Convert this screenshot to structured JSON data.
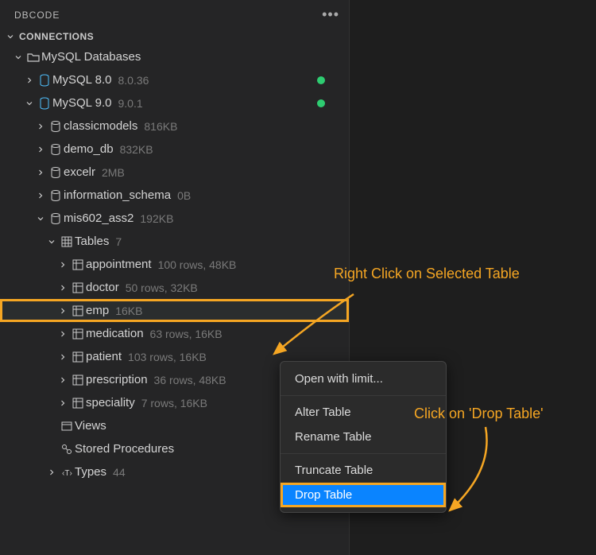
{
  "panel": {
    "title": "DBCODE",
    "section": "CONNECTIONS"
  },
  "tree": {
    "group": "MySQL Databases",
    "servers": [
      {
        "name": "MySQL 8.0",
        "version": "8.0.36",
        "expanded": false,
        "online": true
      },
      {
        "name": "MySQL 9.0",
        "version": "9.0.1",
        "expanded": true,
        "online": true
      }
    ],
    "databases": [
      {
        "name": "classicmodels",
        "size": "816KB"
      },
      {
        "name": "demo_db",
        "size": "832KB"
      },
      {
        "name": "excelr",
        "size": "2MB"
      },
      {
        "name": "information_schema",
        "size": "0B"
      },
      {
        "name": "mis602_ass2",
        "size": "192KB",
        "expanded": true
      }
    ],
    "tables_header": {
      "label": "Tables",
      "count": "7"
    },
    "tables": [
      {
        "name": "appointment",
        "meta": "100 rows, 48KB"
      },
      {
        "name": "doctor",
        "meta": "50 rows, 32KB"
      },
      {
        "name": "emp",
        "meta": "16KB",
        "selected": true
      },
      {
        "name": "medication",
        "meta": "63 rows, 16KB"
      },
      {
        "name": "patient",
        "meta": "103 rows, 16KB"
      },
      {
        "name": "prescription",
        "meta": "36 rows, 48KB"
      },
      {
        "name": "speciality",
        "meta": "7 rows, 16KB"
      }
    ],
    "views": "Views",
    "procs": "Stored Procedures",
    "types": {
      "label": "Types",
      "count": "44"
    }
  },
  "context_menu": {
    "items": [
      "Open with limit...",
      "Alter Table",
      "Rename Table",
      "Truncate Table",
      "Drop Table"
    ],
    "highlight_index": 4
  },
  "annotations": {
    "a1": "Right Click on Selected Table",
    "a2": "Click on 'Drop Table'"
  }
}
